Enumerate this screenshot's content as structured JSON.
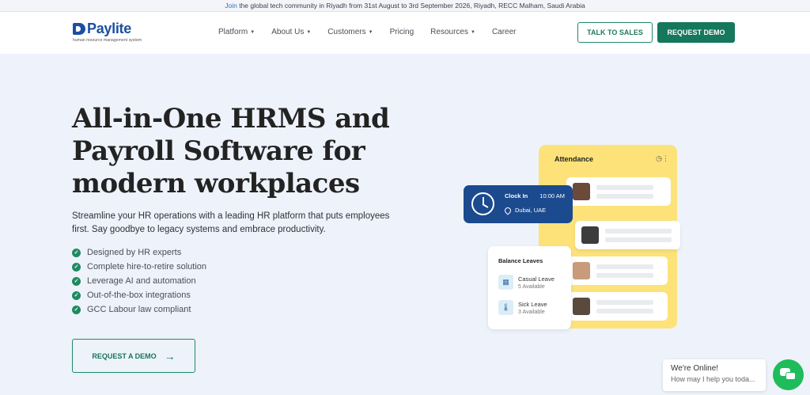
{
  "announcement": {
    "join": "Join",
    "text": " the global tech community in Riyadh from 31st August to 3rd September 2026, Riyadh, RECC Malham, Saudi Arabia"
  },
  "brand": {
    "name": "Paylite",
    "tagline": "human resource management system"
  },
  "nav": {
    "items": [
      {
        "label": "Platform",
        "dropdown": true
      },
      {
        "label": "About Us",
        "dropdown": true
      },
      {
        "label": "Customers",
        "dropdown": true
      },
      {
        "label": "Pricing",
        "dropdown": false
      },
      {
        "label": "Resources",
        "dropdown": true
      },
      {
        "label": "Career",
        "dropdown": false
      }
    ],
    "talk_to_sales": "TALK TO SALES",
    "request_demo": "REQUEST DEMO"
  },
  "hero": {
    "title_lines": [
      "All-in-One HRMS and",
      "Payroll Software for",
      "modern workplaces"
    ],
    "description": "Streamline your HR operations with a leading HR platform that puts employees first. Say goodbye to legacy systems and embrace productivity.",
    "features": [
      "Designed by HR experts",
      "Complete hire-to-retire solution",
      "Leverage AI and automation",
      "Out-of-the-box integrations",
      "GCC Labour law compliant"
    ],
    "cta": "REQUEST A DEMO"
  },
  "illustration": {
    "attendance_title": "Attendance",
    "clock": {
      "label": "Clock In",
      "time": "10:00 AM",
      "location": "Dubai, UAE"
    },
    "leaves": {
      "title": "Balance Leaves",
      "items": [
        {
          "name": "Casual Leave",
          "available": "5 Available"
        },
        {
          "name": "Sick Leave",
          "available": "3 Available"
        }
      ]
    }
  },
  "chat": {
    "title": "We're Online!",
    "subtitle": "How may I help you toda..."
  },
  "colors": {
    "primary_green": "#15775b",
    "brand_blue": "#1c4fa0",
    "attendance_yellow": "#fde27a",
    "chat_green": "#1ebc5b"
  }
}
